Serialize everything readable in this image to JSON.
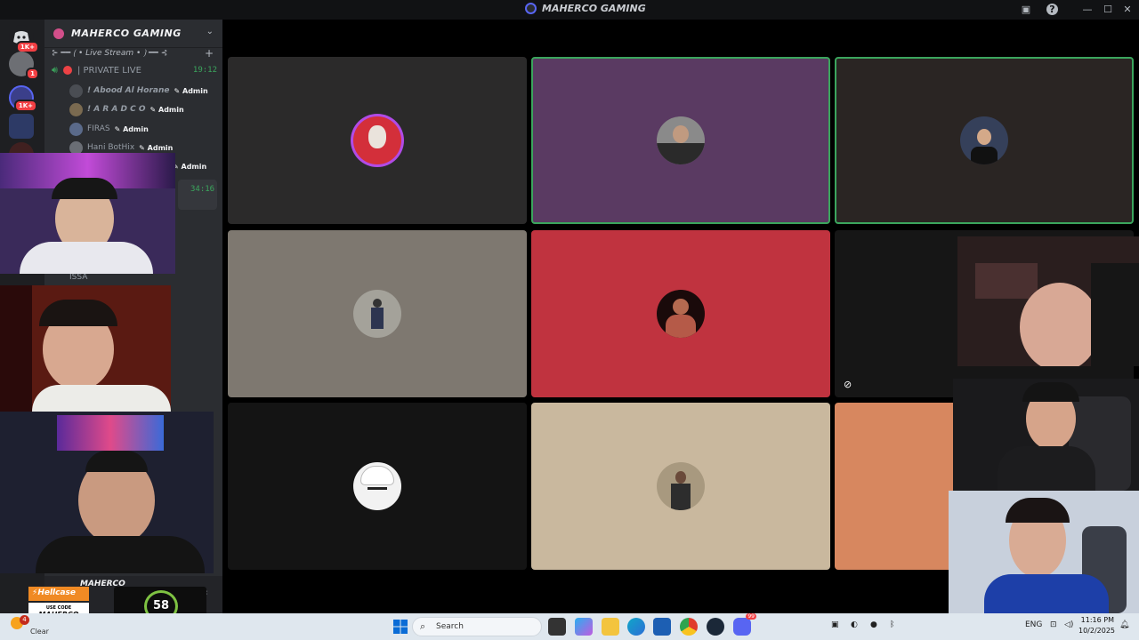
{
  "window": {
    "title": "MAHERCO GAMING"
  },
  "servers": [
    {
      "name": "discord-home",
      "badge": "1K+"
    },
    {
      "name": "server-2",
      "badge": "1"
    },
    {
      "name": "server-3",
      "badge": "1K+"
    },
    {
      "name": "server-4",
      "badge": ""
    },
    {
      "name": "server-5",
      "badge": ""
    }
  ],
  "sidebar": {
    "server_name": "MAHERCO GAMING",
    "category": "⊱ ━━ ⟮ • Live Stream • ⟯ ━━ ⊰",
    "voice_channel": {
      "name": "| PRIVATE LIVE",
      "elapsed": "19:12"
    },
    "voice_users": [
      {
        "name": "! Abood Al Horane",
        "role": "Admin"
      },
      {
        "name": "! A R A D C O",
        "role": "Admin"
      },
      {
        "name": "FIRAS",
        "role": "Admin"
      },
      {
        "name": "Hani BotHix",
        "role": "Admin"
      },
      {
        "name": "",
        "role": "Admin"
      }
    ],
    "second_elapsed": "34:16",
    "member_issa": "ISSA",
    "user_panel_name": "MAHERCO"
  },
  "promo": {
    "brand": "Hellcase",
    "code_label": "USE CODE",
    "code": "MAHERCO",
    "logo_text": "58"
  },
  "taskbar": {
    "weather_label": "Clear",
    "weather_badge": "4",
    "search_placeholder": "Search",
    "language": "ENG",
    "time": "11:16 PM",
    "date": "10/2/2025",
    "discord_badge": "99"
  },
  "colors": {
    "accent": "#5865f2",
    "speaking": "#3ba55d",
    "live": "#ed4245"
  }
}
